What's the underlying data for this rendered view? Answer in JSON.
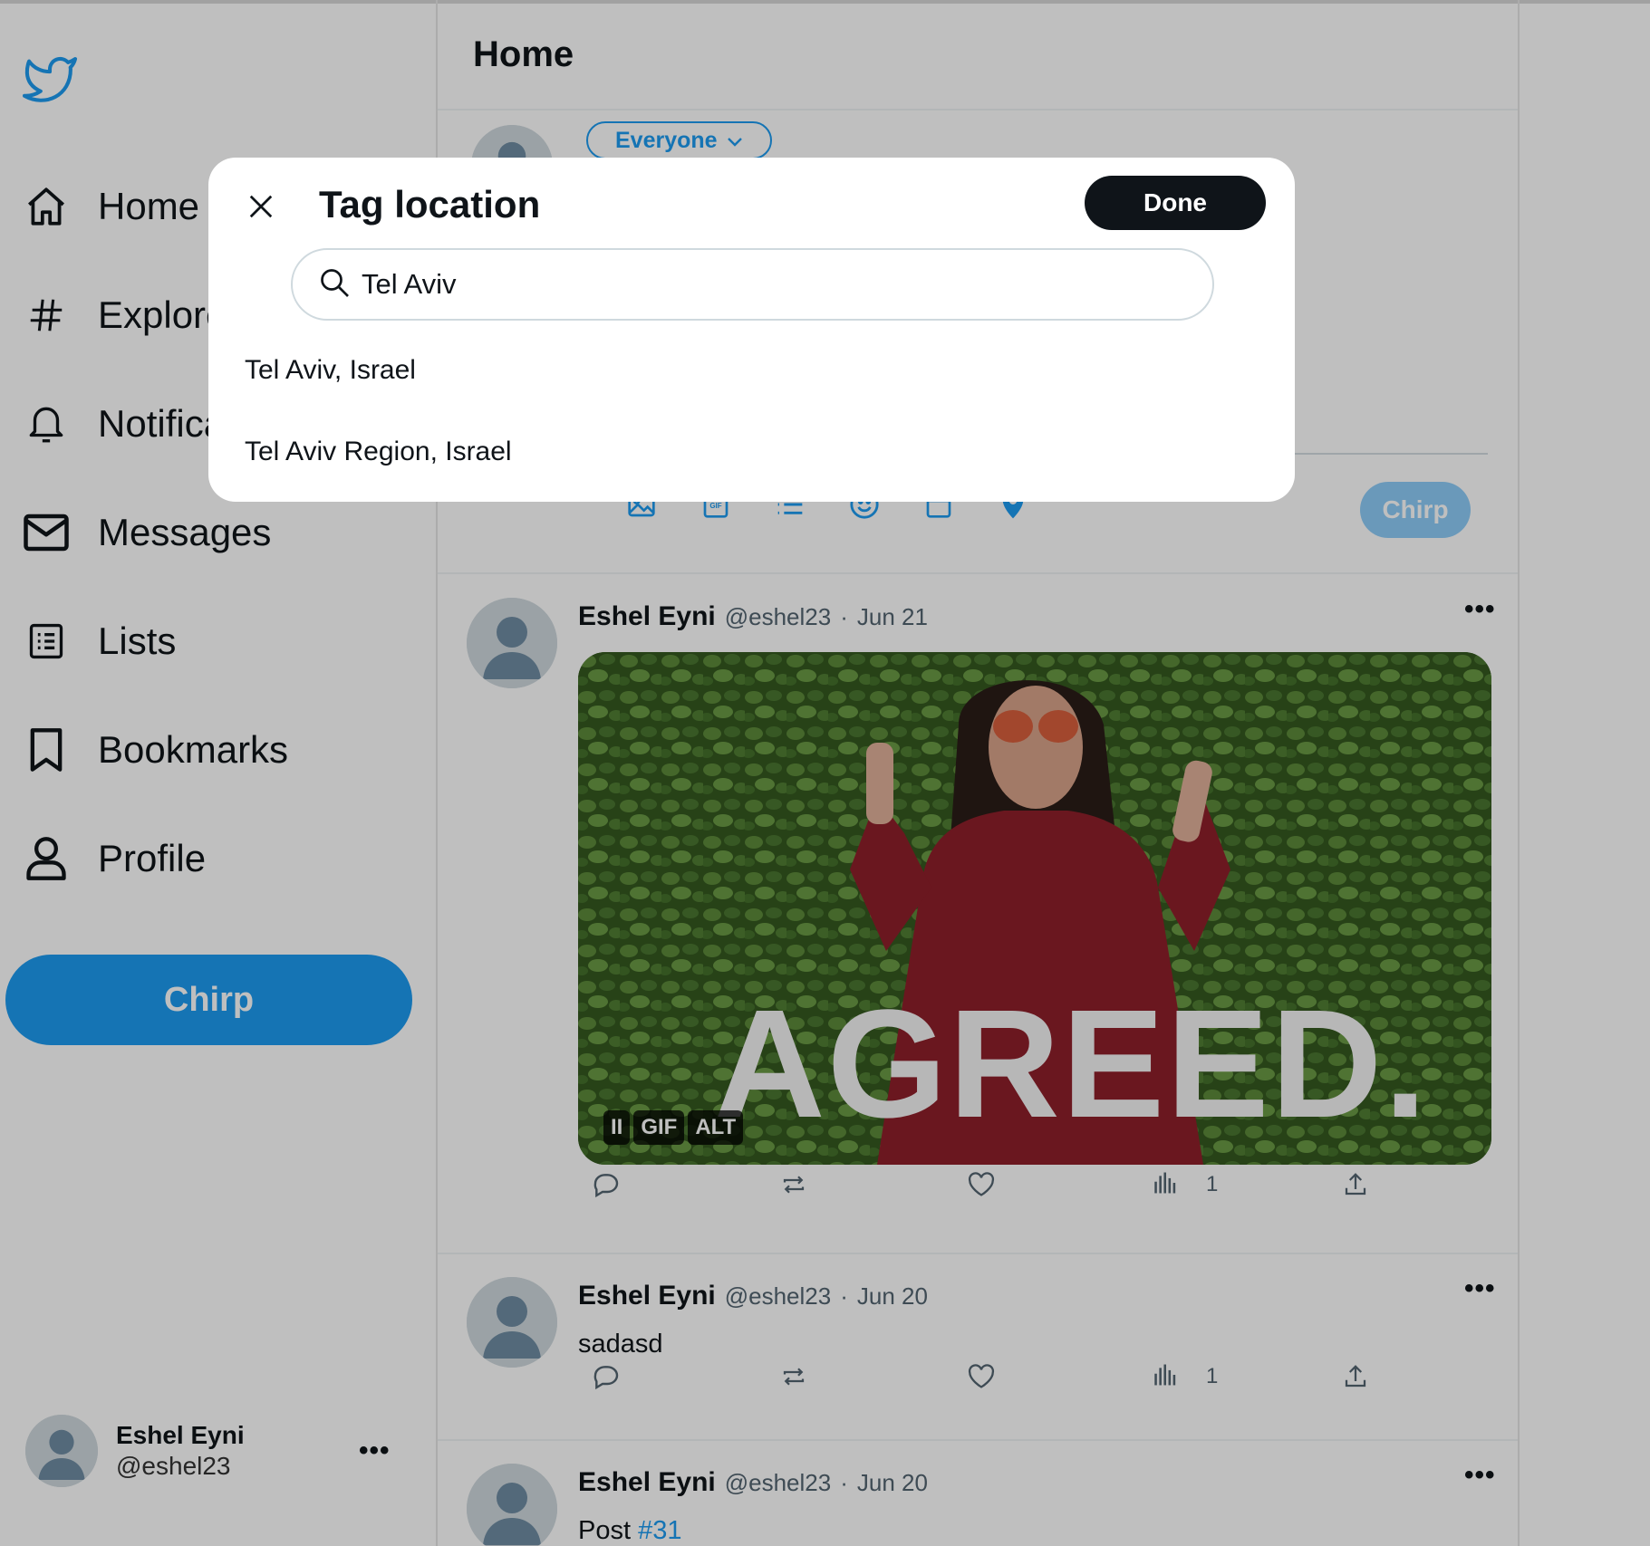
{
  "sidebar": {
    "nav": [
      {
        "label": "Home",
        "icon": "home-icon"
      },
      {
        "label": "Explore",
        "icon": "hashtag-icon"
      },
      {
        "label": "Notifications",
        "icon": "bell-icon"
      },
      {
        "label": "Messages",
        "icon": "envelope-icon"
      },
      {
        "label": "Lists",
        "icon": "list-icon"
      },
      {
        "label": "Bookmarks",
        "icon": "bookmark-icon"
      },
      {
        "label": "Profile",
        "icon": "user-icon"
      }
    ],
    "chirp_label": "Chirp",
    "account": {
      "name": "Eshel Eyni",
      "handle": "@eshel23",
      "more": "•••"
    }
  },
  "main": {
    "title": "Home",
    "compose": {
      "audience": "Everyone",
      "chirp_label": "Chirp"
    },
    "posts": [
      {
        "name": "Eshel Eyni",
        "handle": "@eshel23",
        "dot": "·",
        "date": "Jun 21",
        "media": {
          "caption": "AGREED.",
          "badges": [
            "II",
            "GIF",
            "ALT"
          ]
        },
        "views": "1"
      },
      {
        "name": "Eshel Eyni",
        "handle": "@eshel23",
        "dot": "·",
        "date": "Jun 20",
        "text": "sadasd",
        "views": "1"
      },
      {
        "name": "Eshel Eyni",
        "handle": "@eshel23",
        "dot": "·",
        "date": "Jun 20",
        "text_prefix": "Post ",
        "text_tag": "#31"
      }
    ],
    "more": "•••"
  },
  "modal": {
    "title": "Tag location",
    "done_label": "Done",
    "search_value": "Tel Aviv",
    "results": [
      "Tel Aviv, Israel",
      "Tel Aviv Region, Israel"
    ]
  },
  "colors": {
    "accent": "#1d9bf0",
    "accent_disabled": "#8ecdf8",
    "done_button": "#0f1419",
    "text": "#0f1419",
    "muted": "#536471"
  }
}
